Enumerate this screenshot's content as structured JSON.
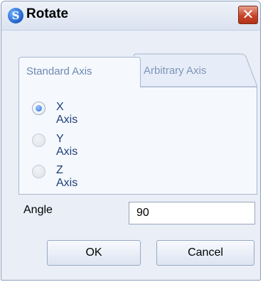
{
  "window": {
    "title": "Rotate",
    "close_label": "✕"
  },
  "tabs": [
    {
      "label": "Standard Axis",
      "active": true
    },
    {
      "label": "Arbitrary Axis",
      "active": false
    }
  ],
  "axis_options": [
    {
      "label": "X Axis",
      "checked": true
    },
    {
      "label": "Y Axis",
      "checked": false
    },
    {
      "label": "Z Axis",
      "checked": false
    }
  ],
  "angle": {
    "label": "Angle",
    "value": "90"
  },
  "buttons": {
    "ok": "OK",
    "cancel": "Cancel"
  }
}
